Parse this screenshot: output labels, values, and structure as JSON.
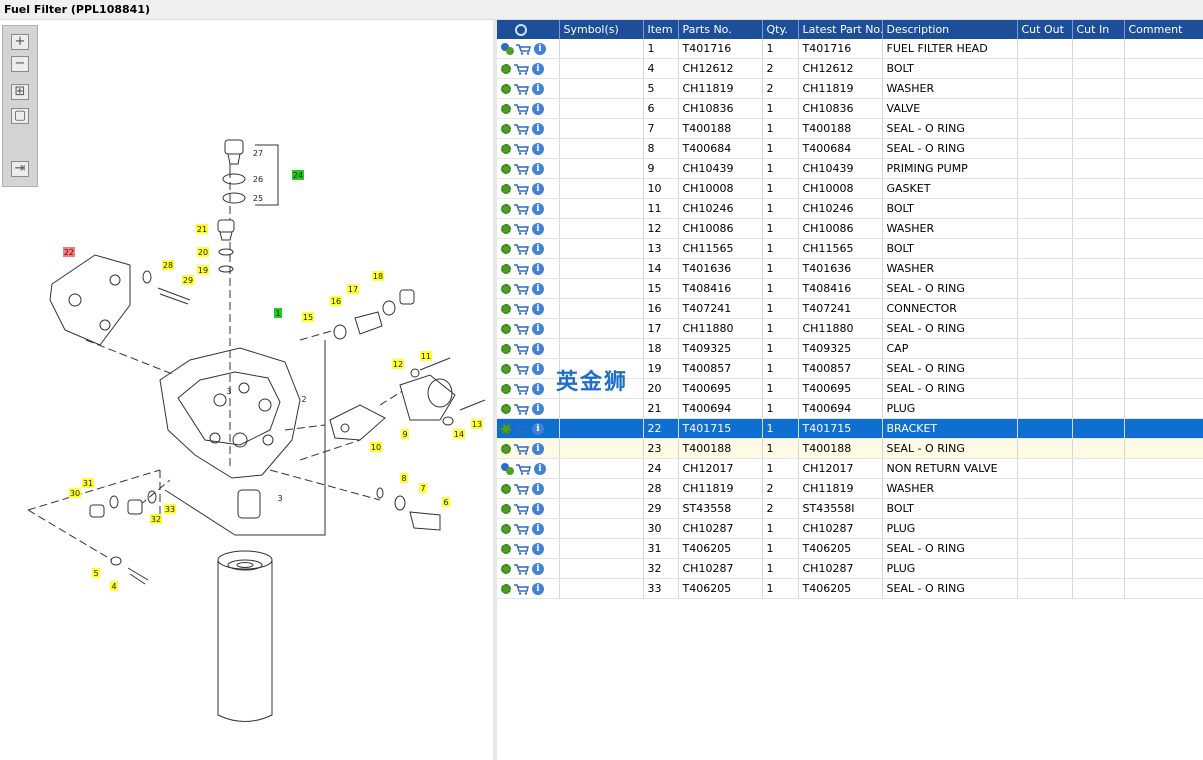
{
  "title": "Fuel Filter (PPL108841)",
  "toolbar": {
    "zoom_in": "+",
    "zoom_out": "−",
    "fit": "⊞",
    "actual": "▢",
    "export": "⇥"
  },
  "columns": [
    "",
    "Symbol(s)",
    "Item",
    "Parts No.",
    "Qty.",
    "Latest Part No.",
    "Description",
    "Cut Out",
    "Cut In",
    "Comment"
  ],
  "rows": [
    {
      "item": "1",
      "part": "T401716",
      "qty": "1",
      "latest": "T401716",
      "desc": "FUEL FILTER HEAD",
      "multi": true
    },
    {
      "item": "4",
      "part": "CH12612",
      "qty": "2",
      "latest": "CH12612",
      "desc": "BOLT"
    },
    {
      "item": "5",
      "part": "CH11819",
      "qty": "2",
      "latest": "CH11819",
      "desc": "WASHER"
    },
    {
      "item": "6",
      "part": "CH10836",
      "qty": "1",
      "latest": "CH10836",
      "desc": "VALVE"
    },
    {
      "item": "7",
      "part": "T400188",
      "qty": "1",
      "latest": "T400188",
      "desc": "SEAL - O RING"
    },
    {
      "item": "8",
      "part": "T400684",
      "qty": "1",
      "latest": "T400684",
      "desc": "SEAL - O RING"
    },
    {
      "item": "9",
      "part": "CH10439",
      "qty": "1",
      "latest": "CH10439",
      "desc": "PRIMING PUMP"
    },
    {
      "item": "10",
      "part": "CH10008",
      "qty": "1",
      "latest": "CH10008",
      "desc": "GASKET"
    },
    {
      "item": "11",
      "part": "CH10246",
      "qty": "1",
      "latest": "CH10246",
      "desc": "BOLT"
    },
    {
      "item": "12",
      "part": "CH10086",
      "qty": "1",
      "latest": "CH10086",
      "desc": "WASHER"
    },
    {
      "item": "13",
      "part": "CH11565",
      "qty": "1",
      "latest": "CH11565",
      "desc": "BOLT"
    },
    {
      "item": "14",
      "part": "T401636",
      "qty": "1",
      "latest": "T401636",
      "desc": "WASHER"
    },
    {
      "item": "15",
      "part": "T408416",
      "qty": "1",
      "latest": "T408416",
      "desc": "SEAL - O RING"
    },
    {
      "item": "16",
      "part": "T407241",
      "qty": "1",
      "latest": "T407241",
      "desc": "CONNECTOR"
    },
    {
      "item": "17",
      "part": "CH11880",
      "qty": "1",
      "latest": "CH11880",
      "desc": "SEAL - O RING"
    },
    {
      "item": "18",
      "part": "T409325",
      "qty": "1",
      "latest": "T409325",
      "desc": "CAP"
    },
    {
      "item": "19",
      "part": "T400857",
      "qty": "1",
      "latest": "T400857",
      "desc": "SEAL - O RING"
    },
    {
      "item": "20",
      "part": "T400695",
      "qty": "1",
      "latest": "T400695",
      "desc": "SEAL - O RING"
    },
    {
      "item": "21",
      "part": "T400694",
      "qty": "1",
      "latest": "T400694",
      "desc": "PLUG"
    },
    {
      "item": "22",
      "part": "T401715",
      "qty": "1",
      "latest": "T401715",
      "desc": "BRACKET",
      "selected": true
    },
    {
      "item": "23",
      "part": "T400188",
      "qty": "1",
      "latest": "T400188",
      "desc": "SEAL - O RING",
      "hover": true
    },
    {
      "item": "24",
      "part": "CH12017",
      "qty": "1",
      "latest": "CH12017",
      "desc": "NON RETURN VALVE",
      "multi": true
    },
    {
      "item": "28",
      "part": "CH11819",
      "qty": "2",
      "latest": "CH11819",
      "desc": "WASHER"
    },
    {
      "item": "29",
      "part": "ST43558",
      "qty": "2",
      "latest": "ST43558I",
      "desc": "BOLT"
    },
    {
      "item": "30",
      "part": "CH10287",
      "qty": "1",
      "latest": "CH10287",
      "desc": "PLUG"
    },
    {
      "item": "31",
      "part": "T406205",
      "qty": "1",
      "latest": "T406205",
      "desc": "SEAL - O RING"
    },
    {
      "item": "32",
      "part": "CH10287",
      "qty": "1",
      "latest": "CH10287",
      "desc": "PLUG"
    },
    {
      "item": "33",
      "part": "T406205",
      "qty": "1",
      "latest": "T406205",
      "desc": "SEAL - O RING"
    }
  ],
  "callouts": [
    {
      "label": "27",
      "color": "none"
    },
    {
      "label": "26",
      "color": "none"
    },
    {
      "label": "25",
      "color": "none"
    },
    {
      "label": "24",
      "color": "#22cc22"
    },
    {
      "label": "21",
      "color": "#ffff33"
    },
    {
      "label": "20",
      "color": "#ffff33"
    },
    {
      "label": "19",
      "color": "#ffff33"
    },
    {
      "label": "22",
      "color": "#ff7777"
    },
    {
      "label": "28",
      "color": "#ffff33"
    },
    {
      "label": "29",
      "color": "#ffff33"
    },
    {
      "label": "18",
      "color": "#ffff33"
    },
    {
      "label": "17",
      "color": "#ffff33"
    },
    {
      "label": "16",
      "color": "#ffff33"
    },
    {
      "label": "15",
      "color": "#ffff33"
    },
    {
      "label": "1",
      "color": "#22cc22"
    },
    {
      "label": "11",
      "color": "#ffff33"
    },
    {
      "label": "12",
      "color": "#ffff33"
    },
    {
      "label": "2",
      "color": "none"
    },
    {
      "label": "3",
      "color": "none"
    },
    {
      "label": "9",
      "color": "#ffff33"
    },
    {
      "label": "10",
      "color": "#ffff33"
    },
    {
      "label": "13",
      "color": "#ffff33"
    },
    {
      "label": "14",
      "color": "#ffff33"
    },
    {
      "label": "8",
      "color": "#ffff33"
    },
    {
      "label": "7",
      "color": "#ffff33"
    },
    {
      "label": "6",
      "color": "#ffff33"
    },
    {
      "label": "31",
      "color": "#ffff33"
    },
    {
      "label": "30",
      "color": "#ffff33"
    },
    {
      "label": "33",
      "color": "#ffff33"
    },
    {
      "label": "32",
      "color": "#ffff33"
    },
    {
      "label": "5",
      "color": "#ffff33"
    },
    {
      "label": "4",
      "color": "#ffff33"
    },
    {
      "label": "3",
      "color": "none"
    }
  ],
  "watermark": "英金狮"
}
